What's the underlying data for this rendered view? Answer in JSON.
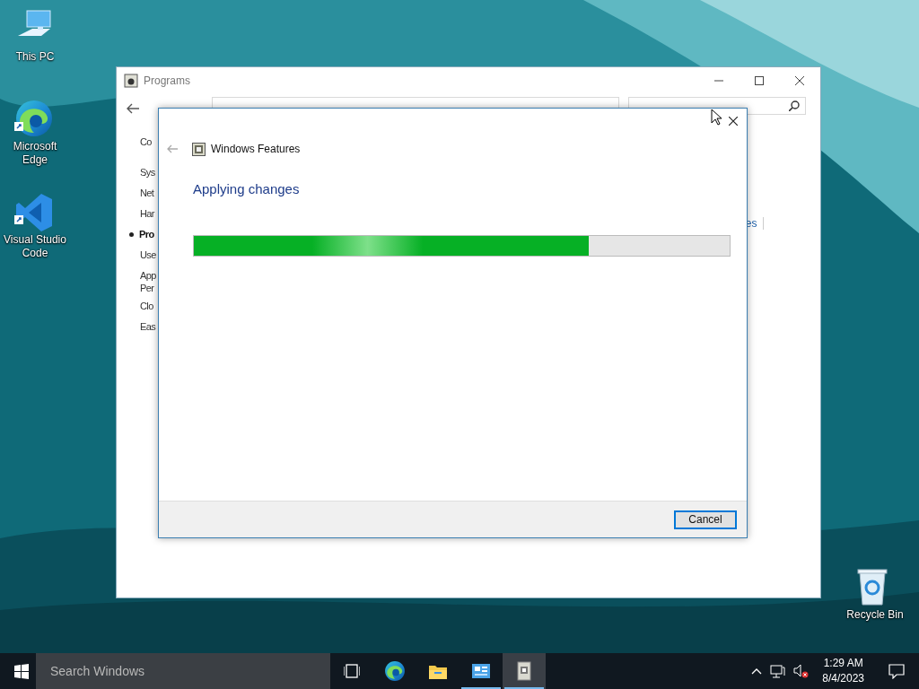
{
  "desktop_icons": [
    {
      "kind": "computer",
      "label": "This PC",
      "shortcut": false
    },
    {
      "kind": "edge",
      "label": "Microsoft Edge",
      "shortcut": true
    },
    {
      "kind": "vscode",
      "label": "Visual Studio Code",
      "shortcut": true
    },
    {
      "kind": "recycle",
      "label": "Recycle Bin",
      "shortcut": false
    }
  ],
  "programs_window": {
    "title": "Programs",
    "nav_heading": "Co",
    "nav_items": [
      {
        "lines": [
          "Sys"
        ],
        "selected": false
      },
      {
        "lines": [
          "Net"
        ],
        "selected": false
      },
      {
        "lines": [
          "Har"
        ],
        "selected": false
      },
      {
        "lines": [
          "Pro"
        ],
        "selected": true
      },
      {
        "lines": [
          "Use"
        ],
        "selected": false
      },
      {
        "lines": [
          "App",
          "Per"
        ],
        "selected": false
      },
      {
        "lines": [
          "Clo"
        ],
        "selected": false
      },
      {
        "lines": [
          "Eas"
        ],
        "selected": false
      }
    ],
    "right_link": "es"
  },
  "dialog": {
    "title": "Windows Features",
    "heading": "Applying changes",
    "progress": {
      "level": 0.737
    },
    "buttons": [
      "Cancel"
    ]
  },
  "taskbar": {
    "search": {
      "placeholder": "Search Windows"
    },
    "apps": [
      {
        "kind": "taskview",
        "running": false,
        "active": false
      },
      {
        "kind": "edge",
        "running": false,
        "active": false
      },
      {
        "kind": "folder",
        "running": false,
        "active": false
      },
      {
        "kind": "controlpanel",
        "running": true,
        "active": false
      },
      {
        "kind": "features",
        "running": true,
        "active": true
      }
    ],
    "time": "1:29 AM",
    "date": "8/4/2023"
  }
}
